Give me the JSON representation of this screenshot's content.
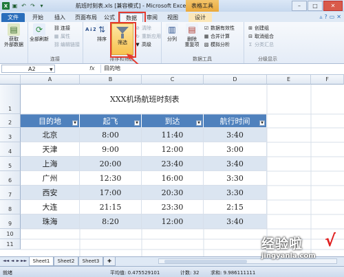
{
  "window": {
    "title": "航班时刻表.xls [兼容模式] - Microsoft Excel",
    "context_tab": "表格工具",
    "buttons": {
      "minimize": "–",
      "maximize": "□",
      "close": "✕"
    }
  },
  "ribbon": {
    "tabs": [
      {
        "label": "文件"
      },
      {
        "label": "开始"
      },
      {
        "label": "插入"
      },
      {
        "label": "页面布局"
      },
      {
        "label": "公式"
      },
      {
        "label": "数据"
      },
      {
        "label": "审阅"
      },
      {
        "label": "视图"
      },
      {
        "label": "设计"
      }
    ],
    "active_tab": "数据",
    "groups": {
      "external": {
        "label": "获取\n外部数据"
      },
      "connections": {
        "refresh_all": "全部刷新",
        "items": [
          "连接",
          "属性",
          "编辑链接"
        ],
        "group_label": "连接"
      },
      "sort_filter": {
        "sort_az": "A↓Z",
        "sort": "排序",
        "filter": "筛选",
        "items": [
          "清除",
          "重新应用",
          "高级"
        ],
        "group_label": "排序和筛选"
      },
      "data_tools": {
        "split": "分列",
        "remove_dup": "删除\n重复项",
        "items": [
          "数据有效性",
          "合并计算",
          "模拟分析"
        ],
        "group_label": "数据工具"
      },
      "outline": {
        "items": [
          "创建组",
          "取消组合",
          "分类汇总"
        ],
        "group_label": "分级显示"
      }
    },
    "accent": "#f7c24f",
    "highlight_color": "#e53a2f"
  },
  "formula_bar": {
    "name_box": "A2",
    "fx": "fx",
    "content": "目的地"
  },
  "sheet": {
    "columns": [
      "A",
      "B",
      "C",
      "D",
      "E",
      "F"
    ],
    "rows": [
      "1",
      "2",
      "3",
      "4",
      "5",
      "6",
      "7",
      "8",
      "9",
      "10",
      "11"
    ],
    "title": "XXX机场航班时刻表",
    "headers": [
      "目的地",
      "起飞",
      "到达",
      "航行时间"
    ],
    "data": [
      [
        "北京",
        "8:00",
        "11:40",
        "3:40"
      ],
      [
        "天津",
        "9:00",
        "12:00",
        "3:00"
      ],
      [
        "上海",
        "20:00",
        "23:40",
        "3:40"
      ],
      [
        "广州",
        "12:30",
        "16:00",
        "3:30"
      ],
      [
        "西安",
        "17:00",
        "20:30",
        "3:30"
      ],
      [
        "大连",
        "21:15",
        "23:30",
        "2:15"
      ],
      [
        "珠海",
        "8:20",
        "12:00",
        "3:40"
      ]
    ],
    "header_color": "#4f81bd",
    "band_color": "#dbe5f1"
  },
  "sheet_tabs": {
    "tabs": [
      "Sheet1",
      "Sheet2",
      "Sheet3"
    ],
    "active": "Sheet1",
    "nav": [
      "◄◄",
      "◄",
      "►",
      "►►"
    ]
  },
  "status_bar": {
    "ready": "就绪",
    "average": "平均值: 0.475529101",
    "count": "计数: 32",
    "sum": "求和: 9.986111111"
  },
  "watermark": {
    "text": "经验啦",
    "url": "jingyanla.com",
    "check": "√"
  }
}
